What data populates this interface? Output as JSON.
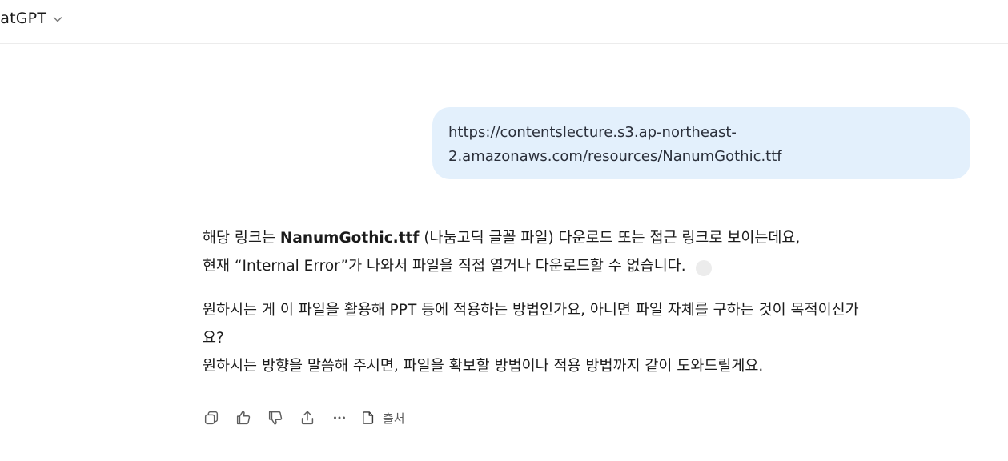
{
  "header": {
    "model_title": "natGPT"
  },
  "user_message": {
    "lines": [
      "https://contentslecture.s3.ap-northeast-",
      "2.amazonaws.com/resources/NanumGothic.ttf"
    ]
  },
  "assistant_message": {
    "p1_prefix": "해당 링크는 ",
    "p1_bold": "NanumGothic.ttf",
    "p1_suffix": " (나눔고딕 글꼴 파일) 다운로드 또는 접근 링크로 보이는데요,",
    "p1_line2": "현재 “Internal Error”가 나와서 파일을 직접 열거나 다운로드할 수 없습니다.",
    "p2_line1": "원하시는 게 이 파일을 활용해 PPT 등에 적용하는 방법인가요, 아니면 파일 자체를 구하는 것이 목적이신가",
    "p2_line2": "요?",
    "p2_line3": "원하시는 방향을 말씀해 주시면, 파일을 확보할 방법이나 적용 방법까지 같이 도와드릴게요."
  },
  "actions": {
    "icons": [
      "copy-icon",
      "thumbs-up-icon",
      "thumbs-down-icon",
      "share-icon",
      "more-icon",
      "document-icon"
    ],
    "sources_label": "출처"
  },
  "colors": {
    "user_bubble_bg": "#e3f0fc",
    "text_primary": "#1b1b1b",
    "icon_gray": "#5d5d5d"
  }
}
